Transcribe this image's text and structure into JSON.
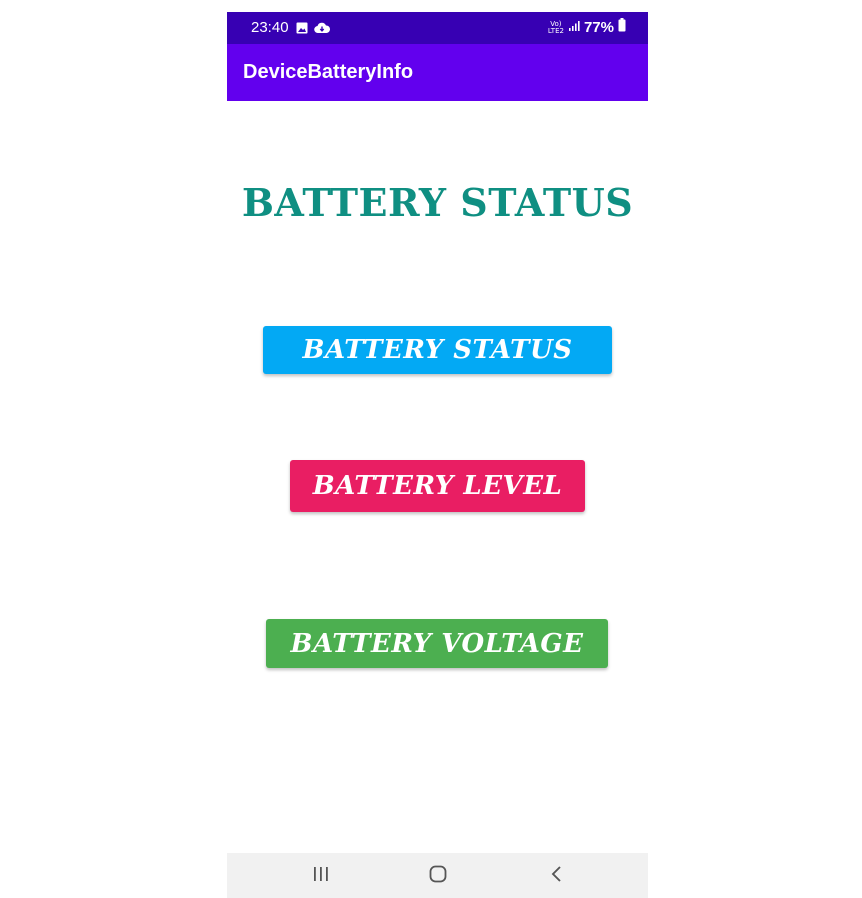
{
  "status_bar": {
    "time": "23:40",
    "icons_left": [
      "image-icon",
      "cloud-download-icon"
    ],
    "network_label_top": "Vo)",
    "network_label_bottom": "LTE2",
    "battery_percent": "77%"
  },
  "app_bar": {
    "title": "DeviceBatteryInfo",
    "color": "#6200ee",
    "status_color": "#3700b3"
  },
  "main": {
    "heading": "BATTERY STATUS",
    "heading_color": "#0f8f82",
    "buttons": [
      {
        "label": "BATTERY STATUS",
        "color": "#03a9f4"
      },
      {
        "label": "BATTERY LEVEL",
        "color": "#e91e63"
      },
      {
        "label": "BATTERY VOLTAGE",
        "color": "#4caf50"
      }
    ]
  },
  "nav_bar": {
    "items": [
      "recents-icon",
      "home-icon",
      "back-icon"
    ]
  }
}
